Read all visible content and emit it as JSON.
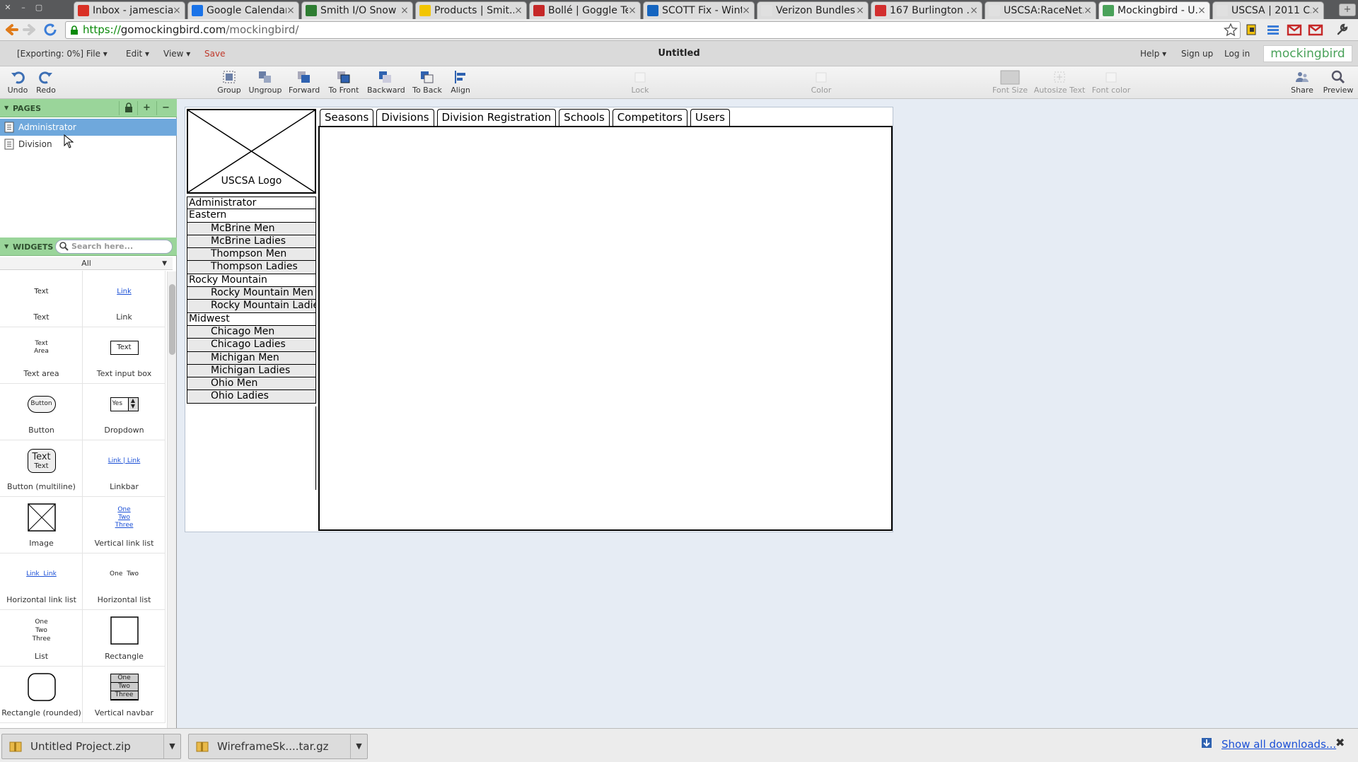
{
  "browser": {
    "tabs": [
      {
        "title": "Inbox - jamescia...",
        "fav": "#d93025",
        "active": false
      },
      {
        "title": "Google Calendar",
        "fav": "#1a73e8",
        "active": false
      },
      {
        "title": "Smith I/O Snow ...",
        "fav": "#2e7d32",
        "active": false
      },
      {
        "title": "Products | Smit...",
        "fav": "#f2c500",
        "active": false
      },
      {
        "title": "Bollé | Goggle Te...",
        "fav": "#c62828",
        "active": false
      },
      {
        "title": "SCOTT Fix - Wint...",
        "fav": "#1565c0",
        "active": false
      },
      {
        "title": "Verizon Bundles ...",
        "fav": "#e0e0e0",
        "active": false
      },
      {
        "title": "167 Burlington ...",
        "fav": "#d32f2f",
        "active": false
      },
      {
        "title": "USCSA:RaceNet...",
        "fav": "#e0e0e0",
        "active": false
      },
      {
        "title": "Mockingbird - U...",
        "fav": "#4aa25a",
        "active": true
      },
      {
        "title": "USCSA | 2011 C...",
        "fav": "#e0e0e0",
        "active": false
      }
    ],
    "new_tab": "+",
    "url": {
      "scheme": "https://",
      "host": "gomockingbird.com",
      "path": "/mockingbird/"
    }
  },
  "menubar": {
    "file": "[Exporting: 0%] File ▾",
    "edit": "Edit ▾",
    "view": "View ▾",
    "save": "Save",
    "title": "Untitled",
    "help": "Help ▾",
    "signup": "Sign up",
    "login": "Log in",
    "brand": "mockingbird"
  },
  "toolbar": {
    "undo": "Undo",
    "redo": "Redo",
    "group": "Group",
    "ungroup": "Ungroup",
    "forward": "Forward",
    "to_front": "To Front",
    "backward": "Backward",
    "to_back": "To Back",
    "align": "Align",
    "lock": "Lock",
    "color": "Color",
    "font_size": "Font Size",
    "autosize": "Autosize Text",
    "font_color": "Font color",
    "share": "Share",
    "preview": "Preview"
  },
  "pages": {
    "header": "PAGES",
    "add": "+",
    "remove": "−",
    "items": [
      {
        "label": "Administrator",
        "selected": true
      },
      {
        "label": "Division",
        "selected": false
      }
    ]
  },
  "widgets": {
    "header": "WIDGETS",
    "search_placeholder": "Search here...",
    "filter": "All",
    "items": [
      {
        "label": "Text",
        "preview": "Text"
      },
      {
        "label": "Link",
        "preview": "Link"
      },
      {
        "label": "Text area",
        "preview": "Text\nArea"
      },
      {
        "label": "Text input box",
        "preview": "Text"
      },
      {
        "label": "Button",
        "preview": "Button"
      },
      {
        "label": "Dropdown",
        "preview": "Yes"
      },
      {
        "label": "Button (multiline)",
        "preview": "Text\nText"
      },
      {
        "label": "Linkbar",
        "preview": "Link | Link"
      },
      {
        "label": "Image",
        "preview": ""
      },
      {
        "label": "Vertical link list",
        "preview": "One\nTwo\nThree"
      },
      {
        "label": "Horizontal link list",
        "preview": "Link  Link"
      },
      {
        "label": "Horizontal list",
        "preview": "One  Two"
      },
      {
        "label": "List",
        "preview": "One\nTwo\nThree"
      },
      {
        "label": "Rectangle",
        "preview": ""
      },
      {
        "label": "Rectangle (rounded)",
        "preview": ""
      },
      {
        "label": "Vertical navbar",
        "preview": "One\nTwo\nThree"
      }
    ]
  },
  "canvas": {
    "logo_label": "USCSA Logo",
    "nav_list": [
      {
        "label": "Administrator",
        "level": 0
      },
      {
        "label": "Eastern",
        "level": 0
      },
      {
        "label": "McBrine Men",
        "level": 1
      },
      {
        "label": "McBrine Ladies",
        "level": 1
      },
      {
        "label": "Thompson Men",
        "level": 1
      },
      {
        "label": "Thompson Ladies",
        "level": 1
      },
      {
        "label": "Rocky Mountain",
        "level": 0
      },
      {
        "label": "Rocky Mountain Men",
        "level": 1
      },
      {
        "label": "Rocky Mountain Ladies",
        "level": 1
      },
      {
        "label": "Midwest",
        "level": 0
      },
      {
        "label": "Chicago Men",
        "level": 1
      },
      {
        "label": "Chicago Ladies",
        "level": 1
      },
      {
        "label": "Michigan Men",
        "level": 1
      },
      {
        "label": "Michigan Ladies",
        "level": 1
      },
      {
        "label": "Ohio Men",
        "level": 1
      },
      {
        "label": "Ohio Ladies",
        "level": 1
      }
    ],
    "tabs": [
      "Seasons",
      "Divisions",
      "Division Registration",
      "Schools",
      "Competitors",
      "Users"
    ]
  },
  "downloads": {
    "items": [
      "Untitled Project.zip",
      "WireframeSk....tar.gz"
    ],
    "show_all": "Show all downloads...",
    "close": "✖"
  },
  "colors": {
    "accent_green": "#9ad59a",
    "selection_blue": "#6fa8dc",
    "brand_green": "#4aa25a",
    "save_red": "#c0392b",
    "canvas_bg": "#e6ecf4"
  }
}
